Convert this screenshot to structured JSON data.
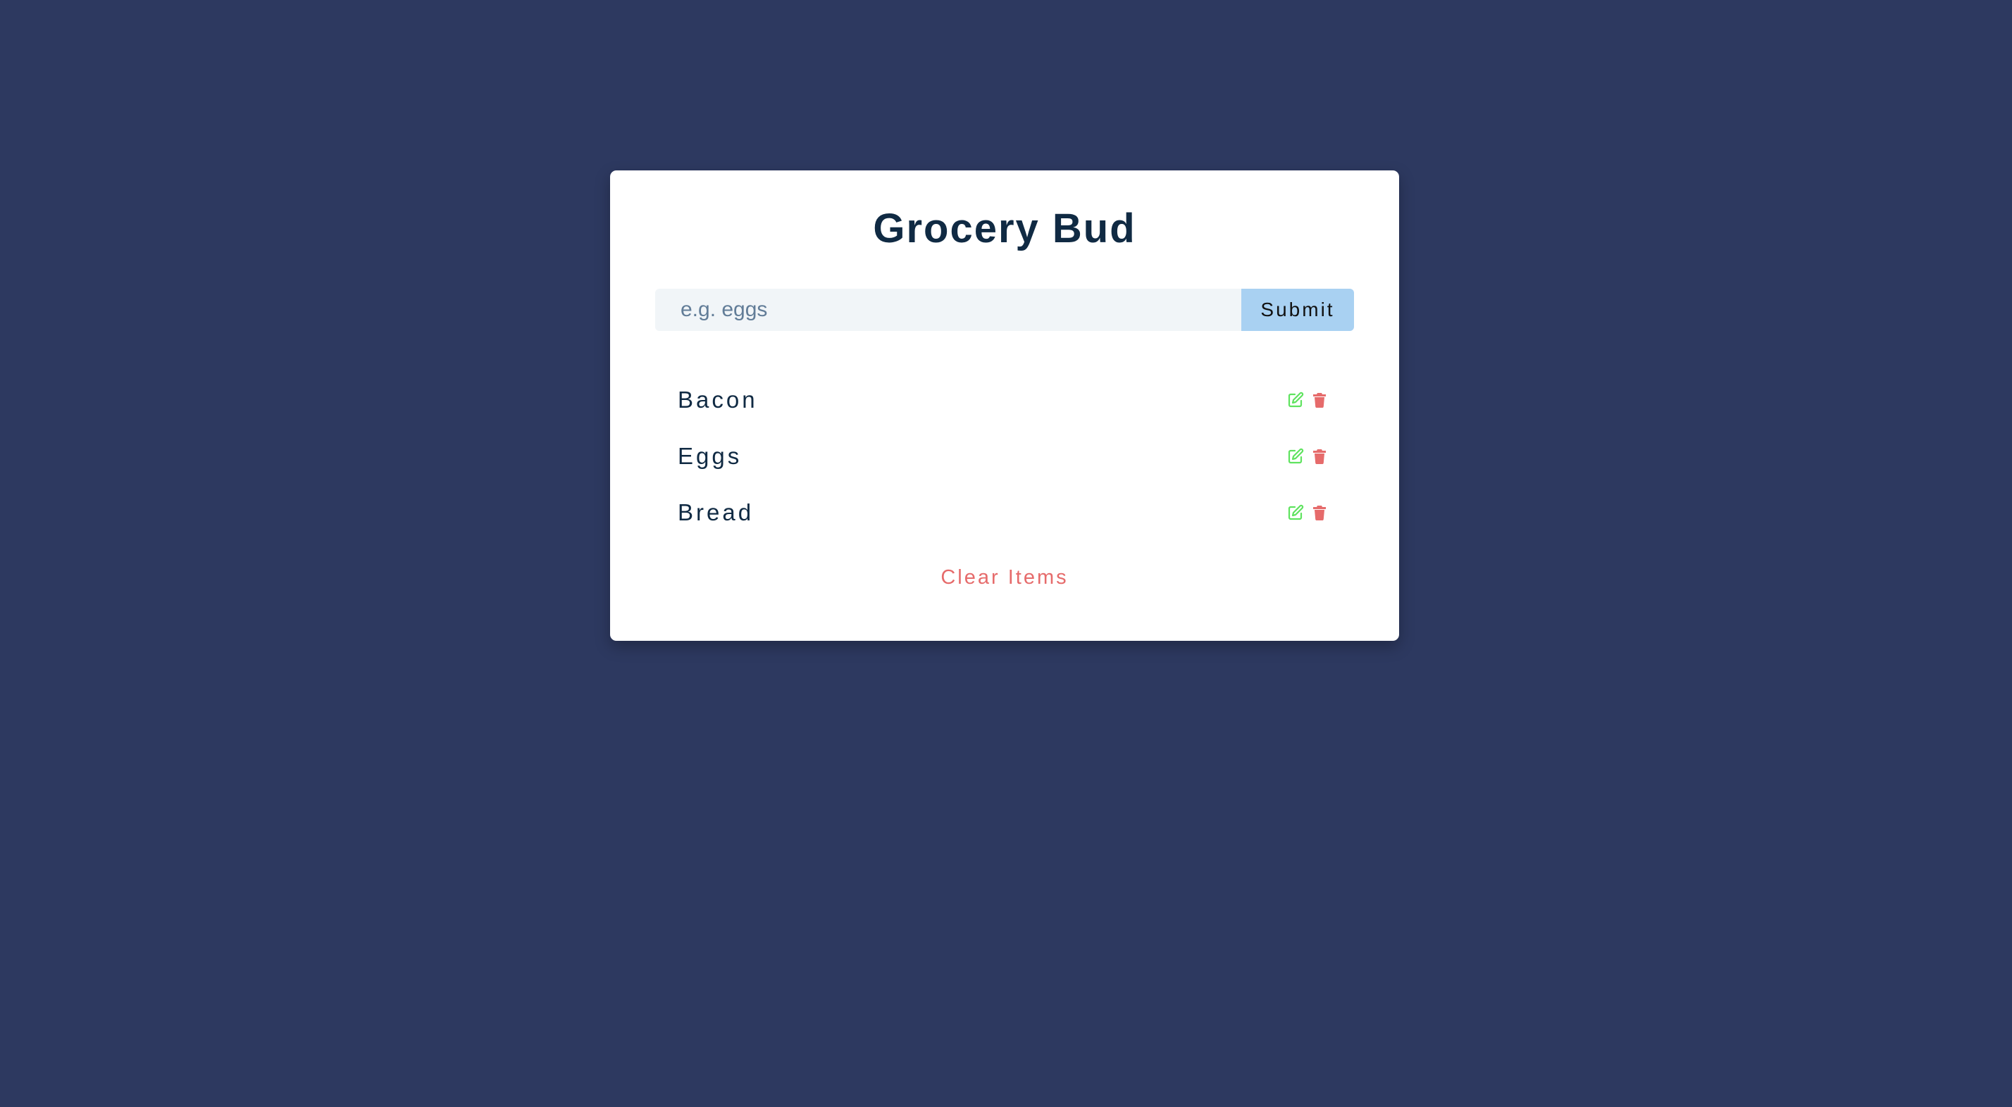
{
  "app": {
    "title": "Grocery Bud"
  },
  "form": {
    "input_value": "",
    "input_placeholder": "e.g. eggs",
    "submit_label": "Submit"
  },
  "items": [
    {
      "name": "Bacon"
    },
    {
      "name": "Eggs"
    },
    {
      "name": "Bread"
    }
  ],
  "icons": {
    "edit": "edit-icon",
    "delete": "trash-icon"
  },
  "colors": {
    "background": "#2d3960",
    "title": "#102a43",
    "submit_bg": "#a9d1f2",
    "edit": "#5fe35f",
    "delete": "#e66b6b",
    "clear": "#e66b6b"
  },
  "clear_label": "Clear Items"
}
